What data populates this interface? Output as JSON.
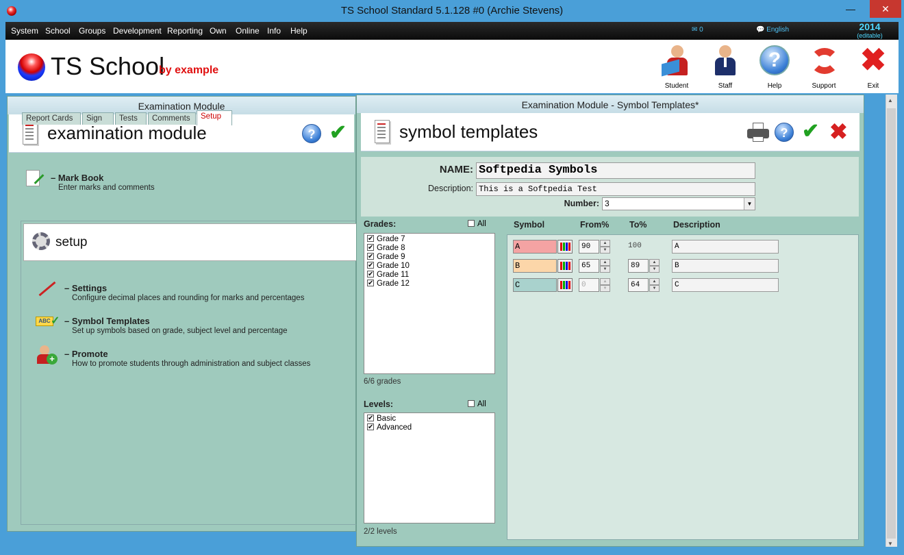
{
  "window": {
    "title": "TS School Standard 5.1.128 #0 (Archie Stevens)",
    "minimize": "—",
    "close": "✕"
  },
  "menu": {
    "items": [
      "System",
      "School",
      "Groups",
      "Development",
      "Reporting",
      "Own",
      "Online",
      "Info",
      "Help"
    ],
    "mail_count": "0",
    "language": "English",
    "year": "2014",
    "year_note": "(editable)"
  },
  "header": {
    "logo": "TS School",
    "logo_sub": "by example",
    "buttons": [
      "Student",
      "Staff",
      "Help",
      "Support",
      "Exit"
    ]
  },
  "left_panel": {
    "title": "Examination Module",
    "heading": "examination module",
    "markbook": {
      "title": "Mark Book",
      "desc": "Enter marks and comments"
    },
    "tabs": [
      "Report Cards",
      "Sign",
      "Tests",
      "Comments",
      "Setup"
    ],
    "setup_heading": "setup",
    "links": [
      {
        "title": "Settings",
        "desc": "Configure decimal places and rounding for marks and percentages"
      },
      {
        "title": "Symbol Templates",
        "desc": "Set up symbols based on grade, subject level and percentage"
      },
      {
        "title": "Promote",
        "desc": "How to promote students through administration and subject classes"
      }
    ]
  },
  "right_panel": {
    "title": "Examination Module - Symbol Templates*",
    "heading": "symbol templates",
    "form": {
      "name_label": "NAME:",
      "name_value": "Softpedia Symbols",
      "desc_label": "Description:",
      "desc_value": "This is a Softpedia Test",
      "number_label": "Number:",
      "number_value": "3"
    },
    "grades": {
      "label": "Grades:",
      "all_label": "All",
      "items": [
        "Grade 7",
        "Grade 8",
        "Grade 9",
        "Grade 10",
        "Grade 11",
        "Grade 12"
      ],
      "count": "6/6 grades"
    },
    "levels": {
      "label": "Levels:",
      "all_label": "All",
      "items": [
        "Basic",
        "Advanced"
      ],
      "count": "2/2 levels"
    },
    "columns": [
      "Symbol",
      "From%",
      "To%",
      "Description"
    ],
    "symbols": [
      {
        "symbol": "A",
        "from": "90",
        "to": "100",
        "desc": "A",
        "color": "#f4a3a3"
      },
      {
        "symbol": "B",
        "from": "65",
        "to": "89",
        "desc": "B",
        "color": "#fcd6a9"
      },
      {
        "symbol": "C",
        "from": "0",
        "to": "64",
        "desc": "C",
        "color": "#a9d2cd"
      }
    ]
  }
}
